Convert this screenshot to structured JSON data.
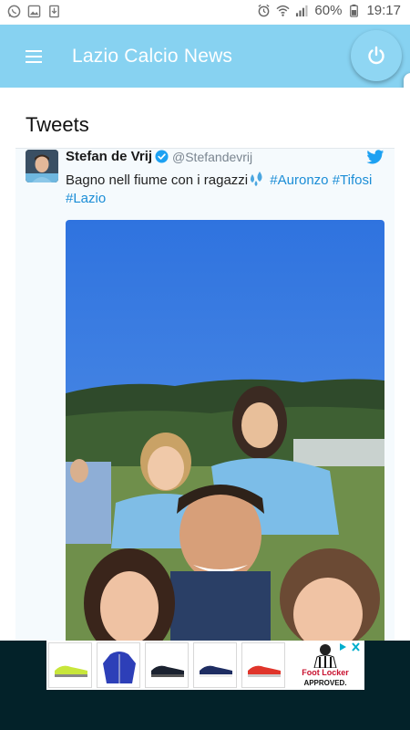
{
  "status_bar": {
    "battery": "60%",
    "time": "19:17"
  },
  "app_bar": {
    "title": "Lazio Calcio News"
  },
  "section": {
    "title": "Tweets"
  },
  "tweet": {
    "author_name": "Stefan de Vrij",
    "author_handle": "@Stefandevrij",
    "text": "Bagno nell fiume con i ragazzi",
    "hashtags": [
      "#Auronzo",
      "#Tifosi",
      "#Lazio"
    ]
  },
  "ad": {
    "brand_line1": "Foot Locker",
    "brand_line2": "APPROVED."
  },
  "colors": {
    "app_bar": "#87d2f1",
    "hashtag": "#1b8dd6",
    "ad_background": "#032229"
  }
}
